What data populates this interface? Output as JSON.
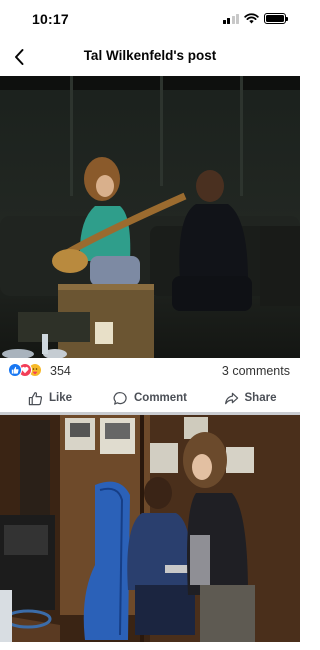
{
  "status_bar": {
    "time": "10:17"
  },
  "header": {
    "title": "Tal Wilkenfeld's post"
  },
  "post": {
    "reaction_count": "354",
    "comments_label": "3 comments"
  },
  "actions": {
    "like": "Like",
    "comment": "Comment",
    "share": "Share"
  },
  "icons": {
    "back": "chevron-left-icon",
    "like_reaction": "thumbs-up-reaction-icon",
    "love_reaction": "heart-reaction-icon",
    "care_reaction": "care-reaction-icon",
    "like": "thumbs-up-icon",
    "comment": "speech-bubble-icon",
    "share": "share-arrow-icon"
  },
  "colors": {
    "like_blue": "#1877f2",
    "love_red": "#f33e58",
    "care_yellow": "#f7b928",
    "action_grey": "#4b4f56",
    "divider": "#c9ccd1"
  }
}
